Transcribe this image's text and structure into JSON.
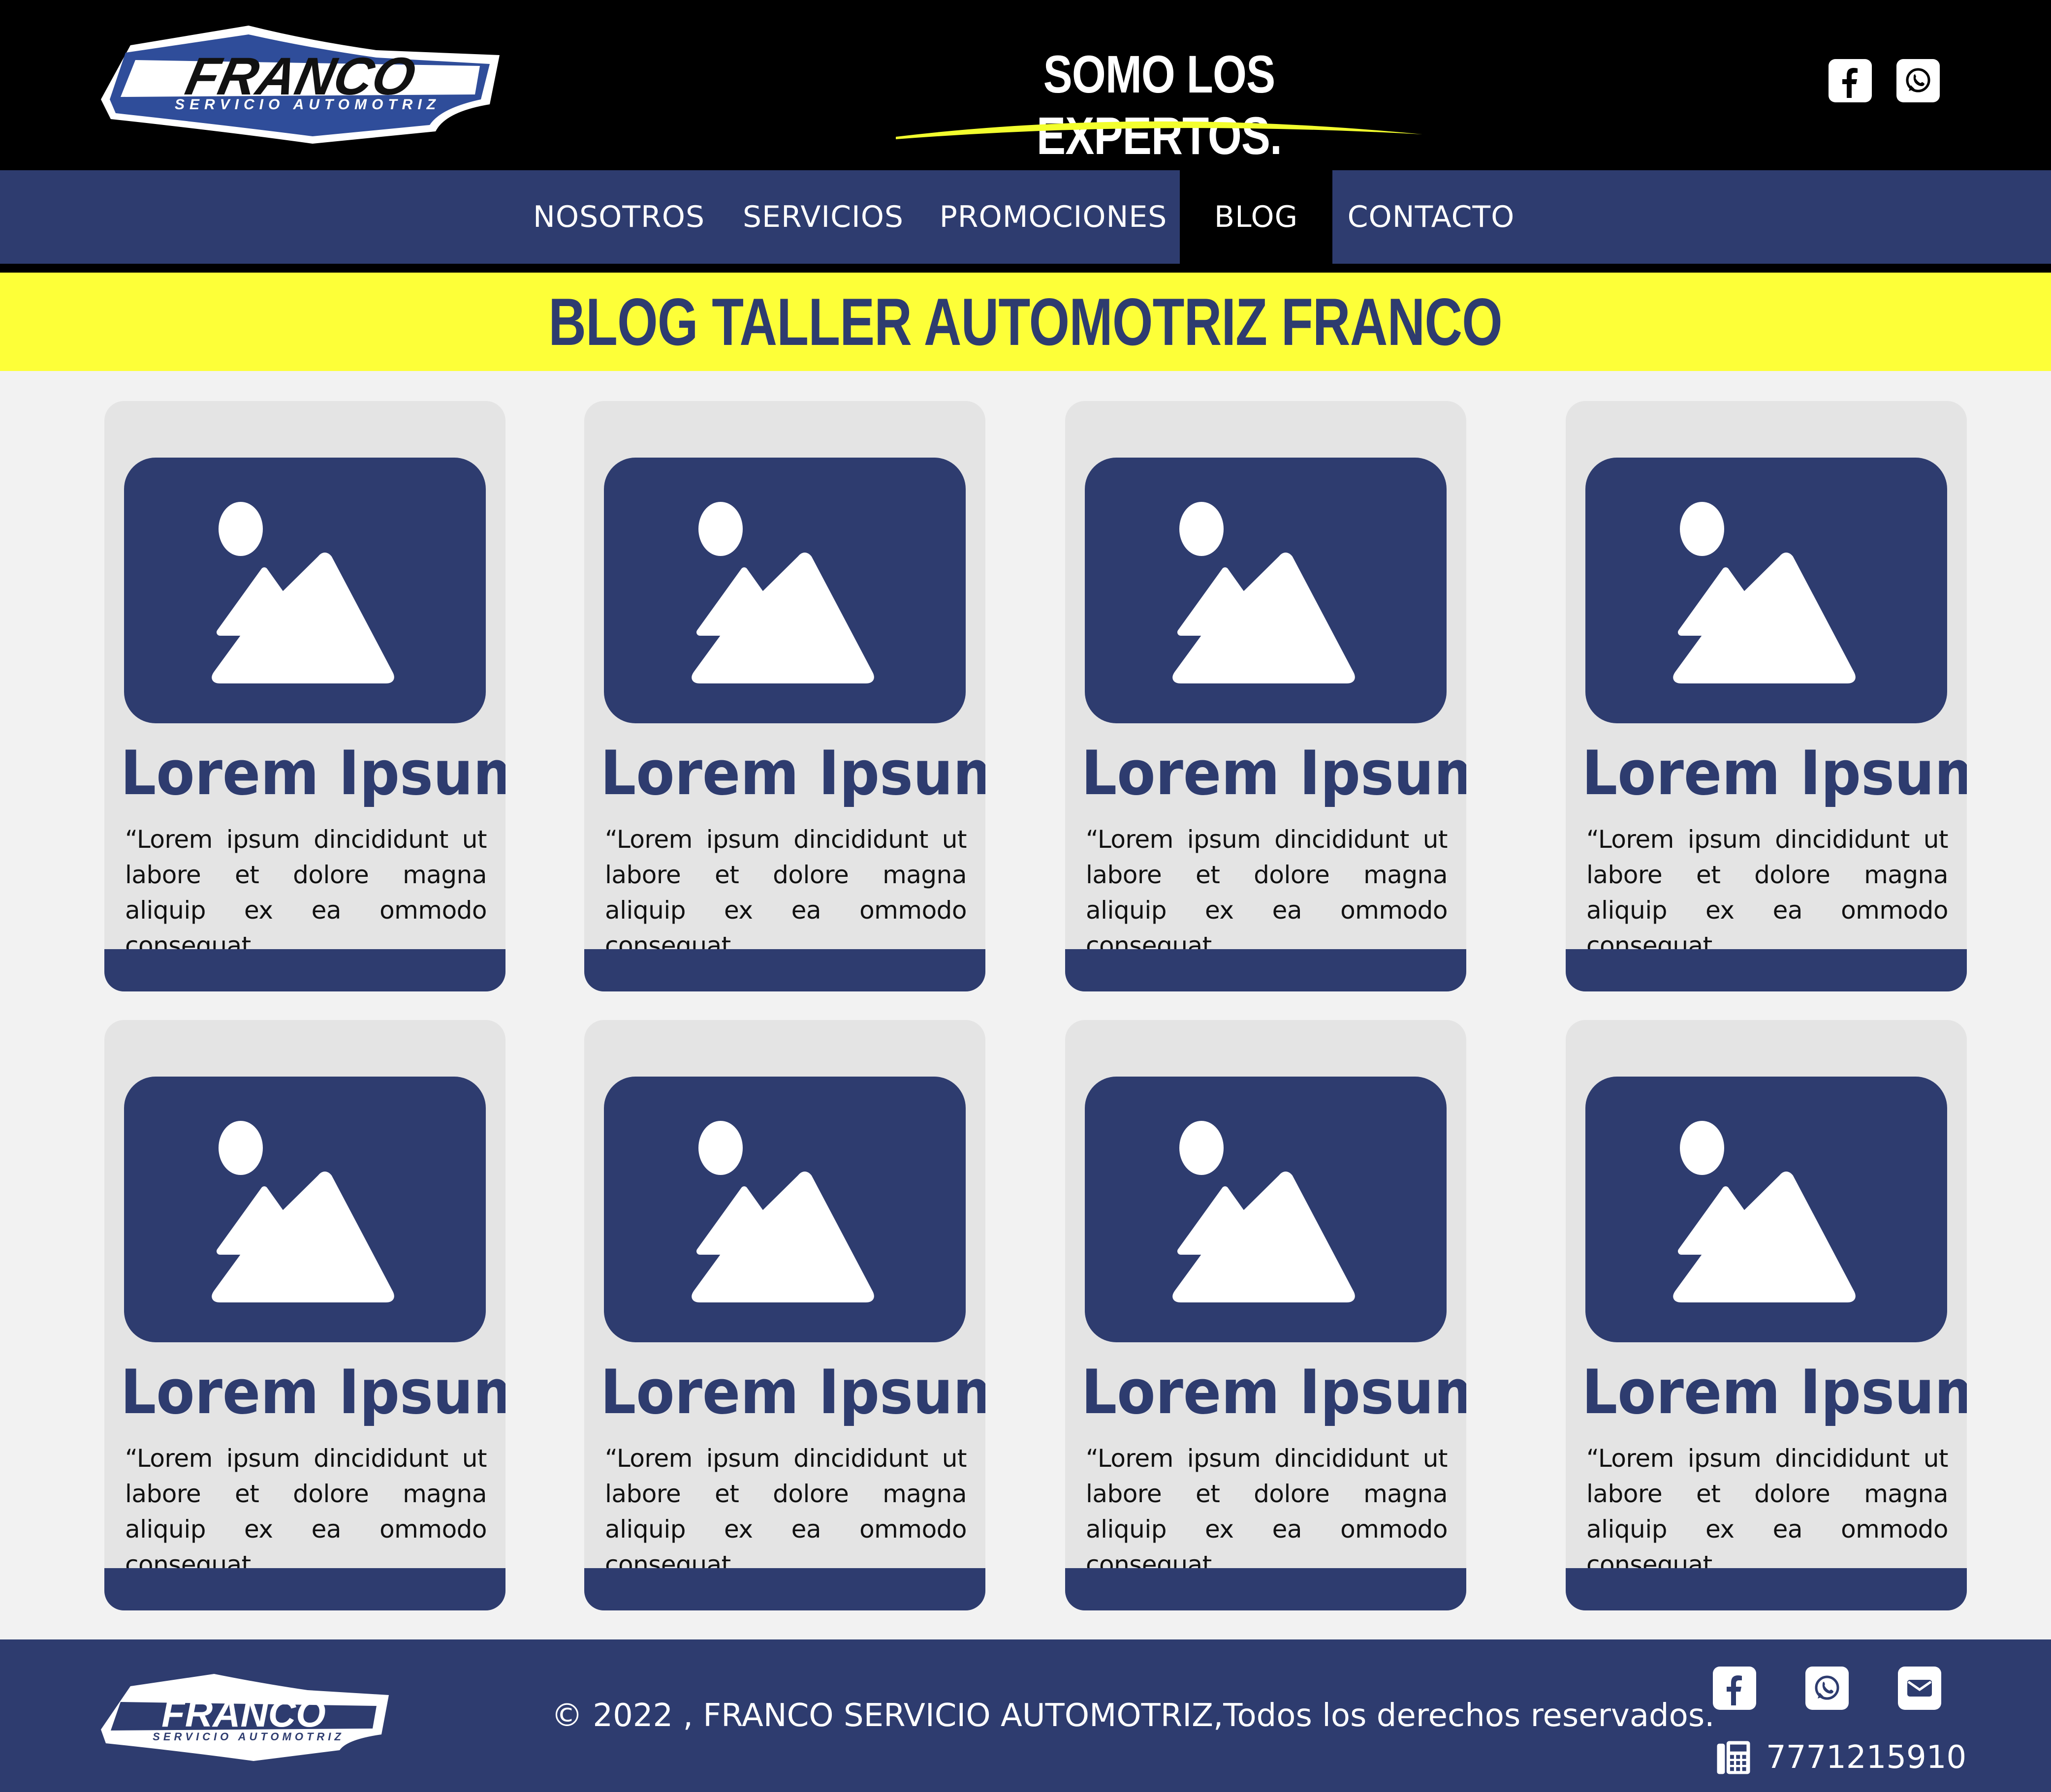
{
  "header": {
    "logo_text": "FRANCO",
    "logo_subtext": "SERVICIO AUTOMOTRIZ",
    "slogan": "SOMO LOS EXPERTOS.",
    "social_icons": [
      "facebook-icon",
      "whatsapp-icon"
    ]
  },
  "nav": {
    "items": [
      {
        "label": "NOSOTROS"
      },
      {
        "label": "SERVICIOS"
      },
      {
        "label": "PROMOCIONES"
      },
      {
        "label": "BLOG"
      },
      {
        "label": "CONTACTO"
      }
    ],
    "active": "BLOG"
  },
  "banner": {
    "title": "BLOG TALLER AUTOMOTRIZ FRANCO"
  },
  "cards": [
    {
      "title": "Lorem Ipsum",
      "text": "“Lorem ipsum dincididunt ut labore et dolore magna aliquip ex ea ommodo consequat."
    },
    {
      "title": "Lorem Ipsum",
      "text": "“Lorem ipsum dincididunt ut labore et dolore magna aliquip ex ea ommodo consequat."
    },
    {
      "title": "Lorem Ipsum",
      "text": "“Lorem ipsum dincididunt ut labore et dolore magna aliquip ex ea ommodo consequat."
    },
    {
      "title": "Lorem Ipsum",
      "text": "“Lorem ipsum dincididunt ut labore et dolore magna aliquip ex ea ommodo consequat."
    },
    {
      "title": "Lorem Ipsum",
      "text": "“Lorem ipsum dincididunt ut labore et dolore magna aliquip ex ea ommodo consequat."
    },
    {
      "title": "Lorem Ipsum",
      "text": "“Lorem ipsum dincididunt ut labore et dolore magna aliquip ex ea ommodo consequat."
    },
    {
      "title": "Lorem Ipsum",
      "text": "“Lorem ipsum dincididunt ut labore et dolore magna aliquip ex ea ommodo consequat."
    },
    {
      "title": "Lorem Ipsum",
      "text": "“Lorem ipsum dincididunt ut labore et dolore magna aliquip ex ea ommodo consequat."
    }
  ],
  "footer": {
    "logo_text": "FRANCO",
    "logo_subtext": "SERVICIO AUTOMOTRIZ",
    "copyright": "© 2022 , FRANCO SERVICIO AUTOMOTRIZ,Todos los derechos reservados.",
    "social_icons": [
      "facebook-icon",
      "whatsapp-icon",
      "email-icon"
    ],
    "phone_icon": "fax-phone-icon",
    "phone": "7771215910"
  },
  "colors": {
    "brand_blue": "#2e3c6f",
    "accent_yellow": "#fdff38",
    "header_black": "#000000",
    "card_bg": "#e4e4e4",
    "page_bg": "#f2f2f2"
  }
}
